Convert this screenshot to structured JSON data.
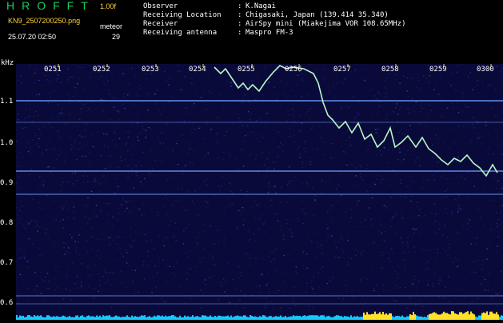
{
  "header": {
    "app_title": "HROFFT",
    "app_version": "1.00f",
    "file_name": "KN9_2507200250.png",
    "mode": "meteor",
    "date_time": "25.07.20 02:50",
    "count": "29"
  },
  "info": [
    {
      "key": "Observer",
      "value": "K.Nagai"
    },
    {
      "key": "Receiving Location",
      "value": "Chigasaki, Japan (139.414 35.340)"
    },
    {
      "key": "Receiver",
      "value": "AirSpy mini (Miakejima VOR 108.65MHz)"
    },
    {
      "key": "Receiving antenna",
      "value": "Maspro FM-3"
    }
  ],
  "spectrogram": {
    "freq_unit": "kHz",
    "y_ticks": [
      "1.1",
      "1.0",
      "0.9",
      "0.8",
      "0.7",
      "0.6"
    ],
    "x_ticks": [
      "0251",
      "0252",
      "0253",
      "0254",
      "0255",
      "0256",
      "0257",
      "0258",
      "0259",
      "0300"
    ],
    "colors": {
      "background": "#0a0a3a",
      "line": "#6fa0ff",
      "trace": "#b9f6c4",
      "bar_low": "#14c8ff",
      "bar_high": "#ffe12a"
    }
  }
}
